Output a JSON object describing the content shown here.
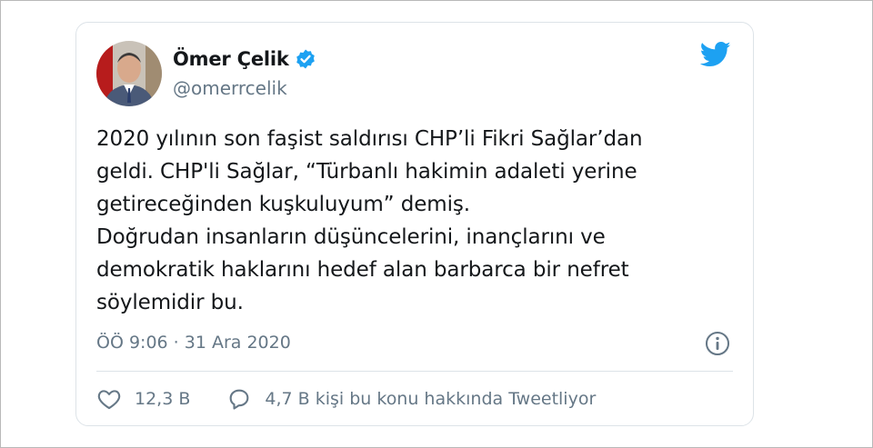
{
  "author": {
    "name": "Ömer Çelik",
    "handle": "@omerrcelik",
    "avatar_icon": "avatar-photo",
    "verified_icon": "verified-badge-icon"
  },
  "brand": {
    "logo_icon": "twitter-bird-icon",
    "accent_color": "#1da1f2"
  },
  "tweet": {
    "lines": [
      "2020 yılının son faşist saldırısı CHP’li Fikri Sağlar’dan",
      "geldi. CHP'li Sağlar, “Türbanlı hakimin adaleti yerine",
      "getireceğinden kuşkuluyum” demiş.",
      "Doğrudan insanların düşüncelerini, inançlarını ve",
      "demokratik haklarını hedef alan barbarca bir nefret",
      "söylemidir bu."
    ]
  },
  "meta": {
    "timestamp": "ÖÖ 9:06 · 31 Ara 2020",
    "info_icon": "info-icon"
  },
  "actions": {
    "likes": {
      "icon": "heart-icon",
      "count": "12,3 B"
    },
    "replies": {
      "icon": "speech-bubble-icon",
      "label": "4,7 B kişi bu konu hakkında Tweetliyor"
    }
  }
}
